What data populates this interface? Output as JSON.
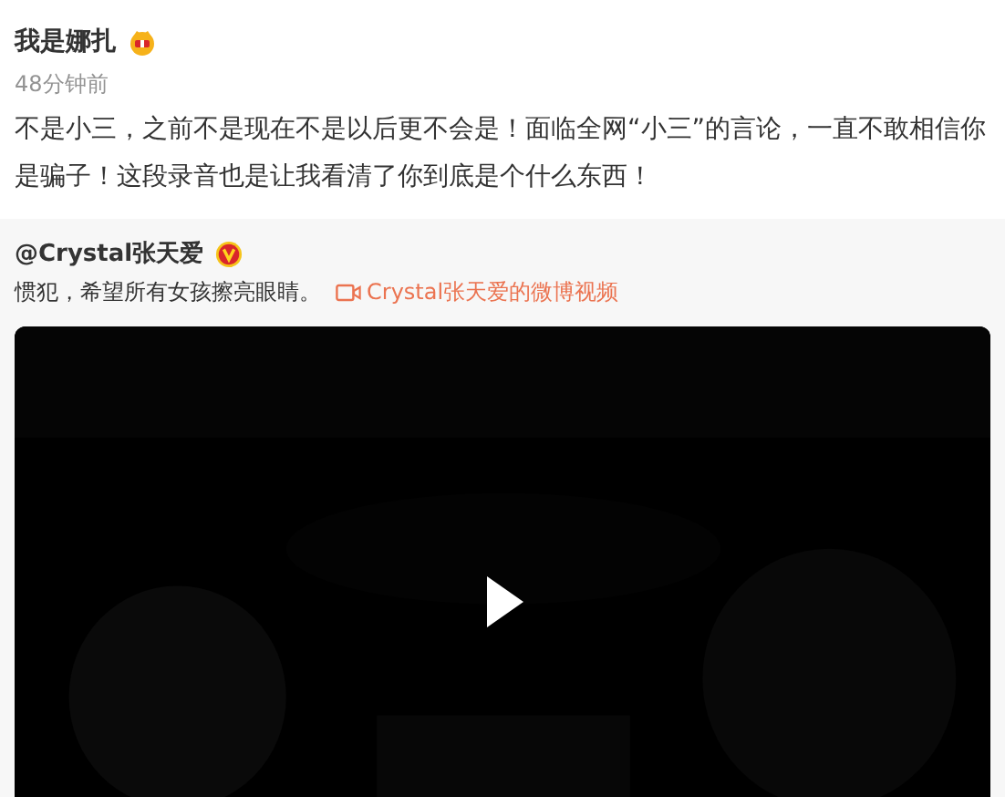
{
  "post": {
    "author": "我是娜扎",
    "time": "48分钟前",
    "text": "不是小三，之前不是现在不是以后更不会是！面临全网“小三”的言论，一直不敢相信你是骗子！这段录音也是让我看清了你到底是个什么东西！"
  },
  "repost": {
    "author": "@Crystal张天爱",
    "verified": true,
    "text": "惯犯，希望所有女孩擦亮眼睛。",
    "link": "Crystal张天爱的微博视频"
  }
}
